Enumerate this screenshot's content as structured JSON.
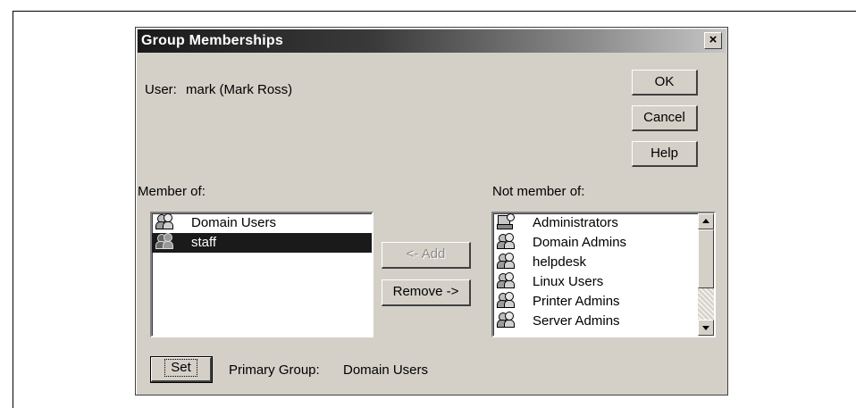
{
  "dialog": {
    "title": "Group Memberships",
    "close_label": "×"
  },
  "user": {
    "label": "User:",
    "value": "mark (Mark Ross)"
  },
  "buttons": {
    "ok": "OK",
    "cancel": "Cancel",
    "help": "Help",
    "add": "<- Add",
    "remove": "Remove ->",
    "set": "Set"
  },
  "member_of": {
    "label": "Member of:",
    "items": [
      {
        "name": "Domain Users",
        "icon": "group-icon",
        "selected": false
      },
      {
        "name": "staff",
        "icon": "group-icon",
        "selected": true
      }
    ]
  },
  "not_member_of": {
    "label": "Not member of:",
    "items": [
      {
        "name": "Administrators",
        "icon": "admin-group-icon"
      },
      {
        "name": "Domain Admins",
        "icon": "group-icon"
      },
      {
        "name": "helpdesk",
        "icon": "group-icon"
      },
      {
        "name": "Linux Users",
        "icon": "group-icon"
      },
      {
        "name": "Printer Admins",
        "icon": "group-icon"
      },
      {
        "name": "Server Admins",
        "icon": "group-icon"
      }
    ]
  },
  "primary_group": {
    "label": "Primary Group:",
    "value": "Domain Users"
  },
  "colors": {
    "dialog_bg": "#d4d0c8",
    "selection_bg": "#1a1a1a",
    "titlebar_start": "#1a1a1a",
    "titlebar_end": "#c6c6c6"
  }
}
